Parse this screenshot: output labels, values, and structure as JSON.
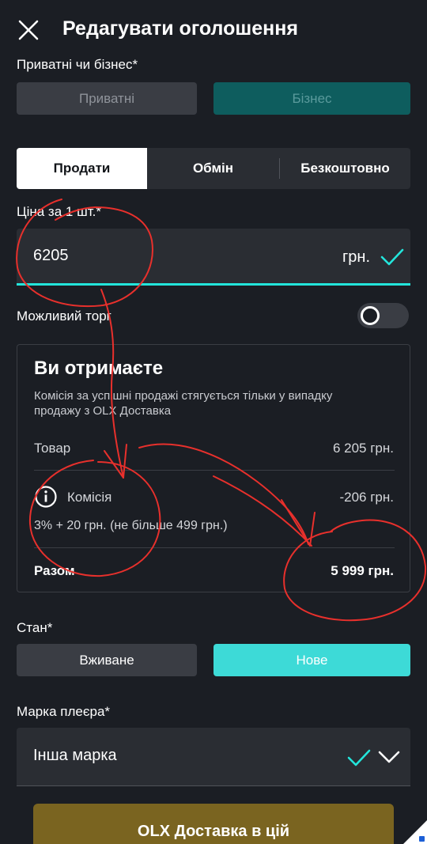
{
  "header": {
    "title": "Редагувати оголошення",
    "close_icon": "close-icon"
  },
  "seller_type": {
    "label": "Приватні чи бізнес*",
    "options": [
      "Приватні",
      "Бізнес"
    ],
    "selected": "Бізнес"
  },
  "deal_tabs": {
    "items": [
      "Продати",
      "Обмін",
      "Безкоштовно"
    ],
    "selected": "Продати"
  },
  "price": {
    "label": "Ціна за 1 шт.*",
    "value": "6205",
    "unit": "грн.",
    "valid_icon": "check-icon"
  },
  "negotiable": {
    "label": "Можливий торг",
    "enabled": false
  },
  "summary": {
    "title": "Ви отримаєте",
    "note": "Комісія за успішні продажі стягується тільки у випадку продажу з OLX Доставка",
    "item_label": "Товар",
    "item_value": "6 205 грн.",
    "fee_label": "Комісія",
    "fee_value": "-206 грн.",
    "fee_formula": "3% + 20 грн. (не більше 499 грн.)",
    "total_label": "Разом",
    "total_value": "5 999 грн."
  },
  "condition": {
    "label": "Стан*",
    "options": [
      "Вживане",
      "Нове"
    ],
    "selected": "Нове"
  },
  "brand": {
    "label": "Марка плеєра*",
    "value": "Інша марка"
  },
  "delivery_button": {
    "label": "OLX Доставка в цій"
  },
  "colors": {
    "background": "#1b1e24",
    "accent": "#23e5db",
    "annotation": "#e8302c",
    "delivery": "#7a6420"
  }
}
